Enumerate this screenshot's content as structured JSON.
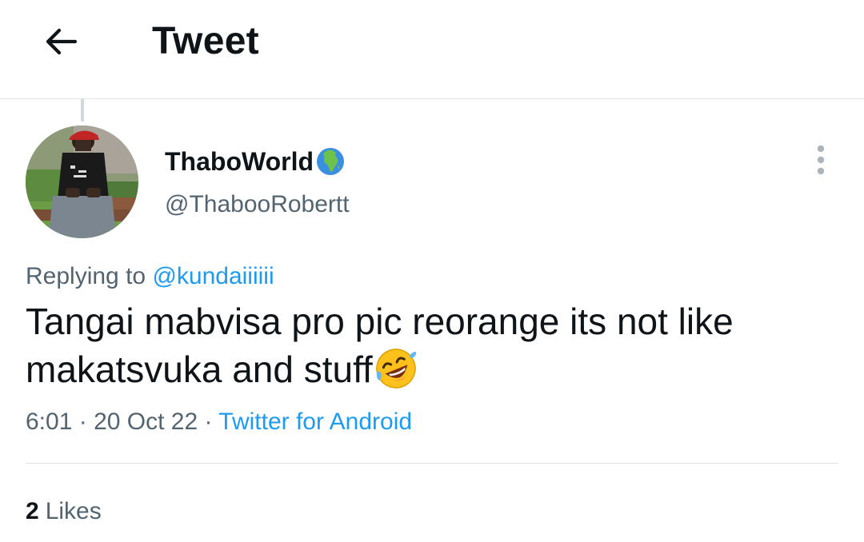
{
  "header": {
    "title": "Tweet",
    "back_icon": "arrow-left-icon"
  },
  "tweet": {
    "author": {
      "display_name": "ThaboWorld",
      "name_emoji": "globe-africa-icon",
      "handle": "@ThabooRobertt"
    },
    "more_icon": "vertical-ellipsis-icon",
    "replying": {
      "prefix": "Replying to",
      "mention": "@kundaiiiiii"
    },
    "text": "Tangai mabvisa pro pic reorange its not like makatsvuka and stuff",
    "text_emoji": "rolling-on-floor-laughing-icon",
    "meta": {
      "time": "6:01",
      "separator": "·",
      "date": "20 Oct 22",
      "source": "Twitter for Android"
    },
    "stats": {
      "likes_count": "2",
      "likes_label": "Likes"
    }
  },
  "colors": {
    "text_primary": "#0f1419",
    "text_secondary": "#536471",
    "link": "#1d9bf0",
    "divider": "#e3e6e8"
  }
}
